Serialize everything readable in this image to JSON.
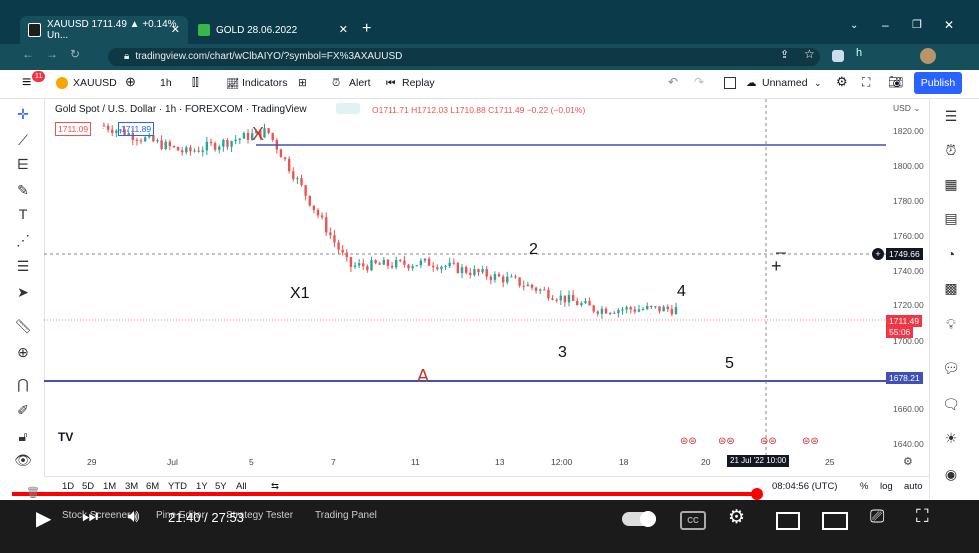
{
  "browser": {
    "tabs": [
      {
        "label": "XAUUSD 1711.49 ▲ +0.14% Un...",
        "fav_color": "#1e1e1e",
        "active": true
      },
      {
        "label": "GOLD 28.06.2022",
        "fav_color": "#3ab54a",
        "active": false
      }
    ],
    "url": "tradingview.com/chart/wClbAIYO/?symbol=FX%3AXAUUSD"
  },
  "toolbar": {
    "symbol": "XAUUSD",
    "interval": "1h",
    "indicators": "Indicators",
    "alert": "Alert",
    "replay": "Replay",
    "layout_name": "Unnamed",
    "publish": "Publish",
    "notif_count": "11"
  },
  "chart": {
    "title": "Gold Spot / U.S. Dollar · 1h · FOREXCOM · TradingView",
    "ohlc": "O1711.71 H1712.03 L1710.88 C1711.49 −0.22 (−0.01%)",
    "bid": "1711.09",
    "ask": "1711.89",
    "currency": "USD",
    "crosshair_price": "1749.66",
    "last_price": "1711.49",
    "countdown": "55:06",
    "support_price": "1678.21",
    "crosshair_time": "21 Jul '22  10:00",
    "price_ticks": [
      "1820.00",
      "1800.00",
      "1780.00",
      "1760.00",
      "1740.00",
      "1720.00",
      "1700.00",
      "1660.00",
      "1640.00"
    ],
    "date_ticks": [
      "29",
      "Jul",
      "5",
      "7",
      "11",
      "13",
      "12:00",
      "18",
      "20",
      "25"
    ],
    "wave_labels": {
      "X": "X",
      "X1": "X1",
      "two": "2",
      "three": "3",
      "four": "4",
      "five": "5",
      "A": "A"
    },
    "colors": {
      "up": "#26a69a",
      "down": "#ef5350",
      "hline": "#3f51b5",
      "label_red": "#c0392b"
    }
  },
  "chart_data": {
    "type": "line",
    "title": "Gold Spot / U.S. Dollar · 1h · FOREXCOM · TradingView",
    "x": [
      "29",
      "Jul",
      "5",
      "7",
      "11",
      "13",
      "12:00",
      "18"
    ],
    "ylabel": "USD",
    "ylim": [
      1630,
      1830
    ],
    "series": [
      {
        "values": [
          1815,
          1800,
          1812,
          1736,
          1738,
          1728,
          1712,
          1712
        ]
      }
    ],
    "annotations": [
      {
        "label": "X",
        "price": 1812
      },
      {
        "label": "A",
        "price": 1678.21
      }
    ]
  },
  "bottom": {
    "ranges": [
      "1D",
      "5D",
      "1M",
      "3M",
      "6M",
      "YTD",
      "1Y",
      "5Y",
      "All"
    ],
    "clock": "08:04:56 (UTC)",
    "pct": "%",
    "log": "log",
    "auto": "auto",
    "tabs": [
      "Stock Screener",
      "Pine Editor",
      "Strategy Tester",
      "Trading Panel"
    ]
  },
  "player": {
    "time": "21:40 / 27:53",
    "progress": 0.78
  }
}
